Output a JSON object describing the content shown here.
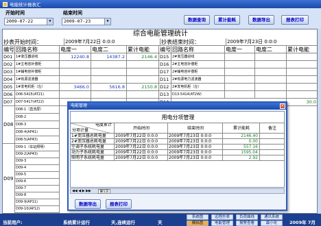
{
  "window": {
    "title": "电能统计报表汇"
  },
  "toolbar": {
    "start_label": "开始时间",
    "end_label": "结束时间",
    "start_date": "2009-07-22",
    "end_date": "2009-07-23",
    "buttons": [
      "数据查询",
      "累计能耗",
      "数据导出",
      "报表打印"
    ]
  },
  "report": {
    "title": "综合电能管理统计",
    "start_caption": "抄表开始时间：",
    "start_value": "2009年7月22日 0:0:0",
    "end_caption": "抄表结束时间：",
    "end_value": "2009年7月23日 0:0:0",
    "headers": [
      "编号",
      "回路名称",
      "电度一",
      "电度二",
      "累计电能",
      "编号",
      "回路名称",
      "电度一",
      "电度二",
      "累计电能"
    ],
    "left_rows": [
      [
        "D01",
        "1#变压器进线",
        "12240.8",
        "14387.2",
        "2146.4"
      ],
      [
        "D02",
        "1#主电容补偿柜",
        "",
        "",
        ""
      ],
      [
        "D03",
        "1#辅电容补偿柜",
        "",
        "",
        ""
      ],
      [
        "D04",
        "1#有源滤波器",
        "",
        "",
        ""
      ],
      [
        "D05",
        "1#发电机柜（左）",
        "3466.0",
        "5616.8",
        "2150.8"
      ],
      [
        "D06",
        "D06-5415(AT21)",
        "",
        "",
        ""
      ],
      [
        "D07",
        "D07-5417(AT22)",
        "",
        "",
        "30.0"
      ]
    ],
    "right_rows": [
      [
        "D15",
        "2#变压器进线",
        "",
        "",
        ""
      ],
      [
        "D16",
        "2#主电容补偿柜",
        "",
        "",
        ""
      ],
      [
        "D17",
        "2#辅电容补偿柜",
        "",
        "",
        ""
      ],
      [
        "D11",
        "2#有源电力滤波器",
        "",
        "",
        ""
      ],
      [
        "D12",
        "2#发电机柜（左）",
        "",
        "",
        ""
      ],
      [
        "D13",
        "D13-5414(AT2W)",
        "",
        "",
        ""
      ],
      [
        "D14",
        "",
        "",
        "",
        ""
      ]
    ],
    "d08": {
      "id": "D08",
      "subs": [
        "D08-1（直流屏）",
        "D08-2",
        "D08-3",
        "D08-4(AP41)",
        "D08-5(AP43)"
      ]
    },
    "d09": {
      "id": "D09",
      "subs": [
        "D09-1（车站照明）",
        "D09-2(AP43)",
        "D09-3",
        "D09-4",
        "D09-5",
        "D09-6",
        "D09-7",
        "D09-8",
        "D09-9(AP11)",
        "D09-10(AP12)"
      ]
    }
  },
  "dialog": {
    "title": "电能管理",
    "sheet_title": "用电分项管理",
    "diag_top": "电度累计",
    "diag_bottom": "分项计量",
    "headers": [
      "开始时间",
      "结束时间",
      "累计能耗",
      "备注"
    ],
    "rows": [
      [
        "1#变压器总耗电量",
        "2009年7月22日 0:0:0",
        "2009年7月23日 0:0:0",
        "2146.40"
      ],
      [
        "2#变压器总耗电量",
        "2009年7月22日 0:0:0",
        "2009年7月23日 0:0:0",
        "0.00"
      ],
      [
        "空调子系统耗电量",
        "2009年7月22日 0:0:0",
        "2009年7月23日 0:0:0",
        "557.16"
      ],
      [
        "动力子系统耗电量",
        "2009年7月22日 0:0:0",
        "2009年7月23日 0:0:0",
        "1595.04"
      ],
      [
        "照明子系统耗电量",
        "2009年7月22日 0:0:0",
        "2009年7月23日 0:0:0",
        "2.92"
      ]
    ],
    "sheet_tab": "第1页",
    "buttons": [
      "数据导出",
      "报表打印"
    ]
  },
  "status": {
    "user_label": "当前用户:",
    "run_label": "系统累计运行",
    "days_label": "天,连续运行",
    "days2_label": "天",
    "date_text": "2009年 7月",
    "buttons_row1": [
      "系统图",
      "远程抄表",
      "负荷曲线",
      "通讯系统"
    ],
    "buttons_row2": [
      "模拟图",
      "电能管理",
      "报警查看",
      "最小化"
    ]
  }
}
